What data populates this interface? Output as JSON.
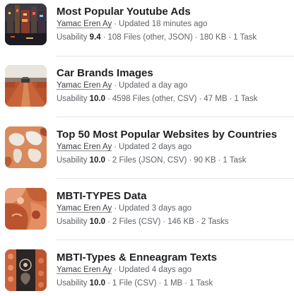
{
  "datasets": [
    {
      "title": "Most Popular Youtube Ads",
      "author": "Yamac Eren Ay",
      "updated": "Updated 18 minutes ago",
      "usability_label": "Usability",
      "usability_score": "9.4",
      "files": "108 Files (other, JSON)",
      "size": "180 KB",
      "tasks": "1 Task",
      "thumb_icon": "city-street-night-image"
    },
    {
      "title": "Car Brands Images",
      "author": "Yamac Eren Ay",
      "updated": "Updated a day ago",
      "usability_label": "Usability",
      "usability_score": "10.0",
      "files": "4598 Files (other, CSV)",
      "size": "47 MB",
      "tasks": "1 Task",
      "thumb_icon": "desert-road-image"
    },
    {
      "title": "Top 50 Most Popular Websites by Countries",
      "author": "Yamac Eren Ay",
      "updated": "Updated 2 days ago",
      "usability_label": "Usability",
      "usability_score": "10.0",
      "files": "2 Files (JSON, CSV)",
      "size": "90 KB",
      "tasks": "1 Task",
      "thumb_icon": "world-map-image"
    },
    {
      "title": "MBTI-TYPES Data",
      "author": "Yamac Eren Ay",
      "updated": "Updated 3 days ago",
      "usability_label": "Usability",
      "usability_score": "10.0",
      "files": "2 Files (CSV)",
      "size": "146 KB",
      "tasks": "2 Tasks",
      "thumb_icon": "abstract-orange-image"
    },
    {
      "title": "MBTI-Types & Enneagram Texts",
      "author": "Yamac Eren Ay",
      "updated": "Updated 4 days ago",
      "usability_label": "Usability",
      "usability_score": "10.0",
      "files": "1 File (CSV)",
      "size": "1 MB",
      "tasks": "1 Task",
      "thumb_icon": "enneagram-pattern-image"
    }
  ],
  "separator": "·"
}
